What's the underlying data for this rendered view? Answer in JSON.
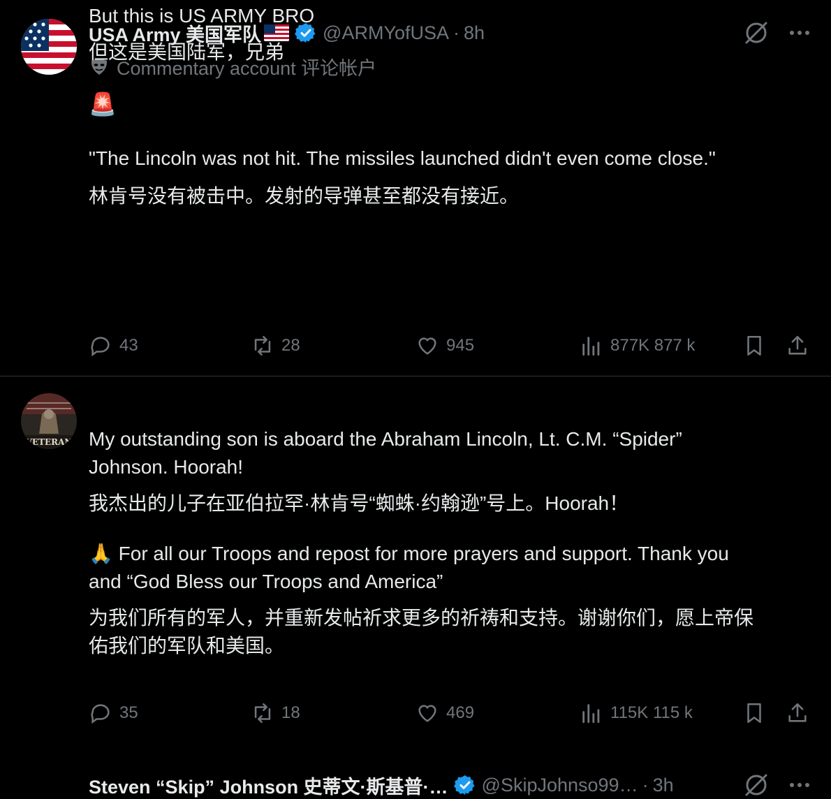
{
  "posts": [
    {
      "name": "USA Army 美国军队",
      "handle": "@ARMYofUSA",
      "time": "8h",
      "commentary": "Commentary account 评论帐户",
      "lines": [
        "But this is US ARMY BRO",
        "但这是美国陆军，兄弟",
        "🚨",
        "\"The Lincoln was not hit. The missiles launched didn't even come close.\"",
        "林肯号没有被击中。发射的导弹甚至都没有接近。"
      ],
      "stats": {
        "replies": "43",
        "reposts": "28",
        "likes": "945",
        "views": "877K 877 k"
      }
    },
    {
      "name": "Steven “Skip” Johnson 史蒂文·斯基普·…",
      "handle": "@SkipJohnso99…",
      "time": "3h",
      "lines": [
        "My outstanding son is aboard the Abraham Lincoln, Lt. C.M. “Spider”",
        "Johnson. Hoorah!",
        "我杰出的儿子在亚伯拉罕·林肯号“蜘蛛·约翰逊”号上。Hoorah！",
        "🙏 For all our Troops and repost for more prayers and support. Thank you",
        "and “God Bless our Troops and America”",
        "为我们所有的军人，并重新发帖祈求更多的祈祷和支持。谢谢你们，愿上帝保",
        "佑我们的军队和美国。"
      ],
      "stats": {
        "replies": "35",
        "reposts": "18",
        "likes": "469",
        "views": "115K 115 k"
      }
    }
  ],
  "separator": "·",
  "avatar2_text": "VETERAN",
  "colors": {
    "background": "#000000",
    "text": "#e7e9ea",
    "muted": "#71767b",
    "verified": "#1d9bf0",
    "divider": "#2f3336"
  },
  "icons": [
    "flag-icon",
    "verified-badge-icon",
    "grok-icon",
    "more-icon",
    "commentary-mask-icon",
    "reply-icon",
    "repost-icon",
    "like-icon",
    "views-icon",
    "bookmark-icon",
    "share-icon"
  ]
}
